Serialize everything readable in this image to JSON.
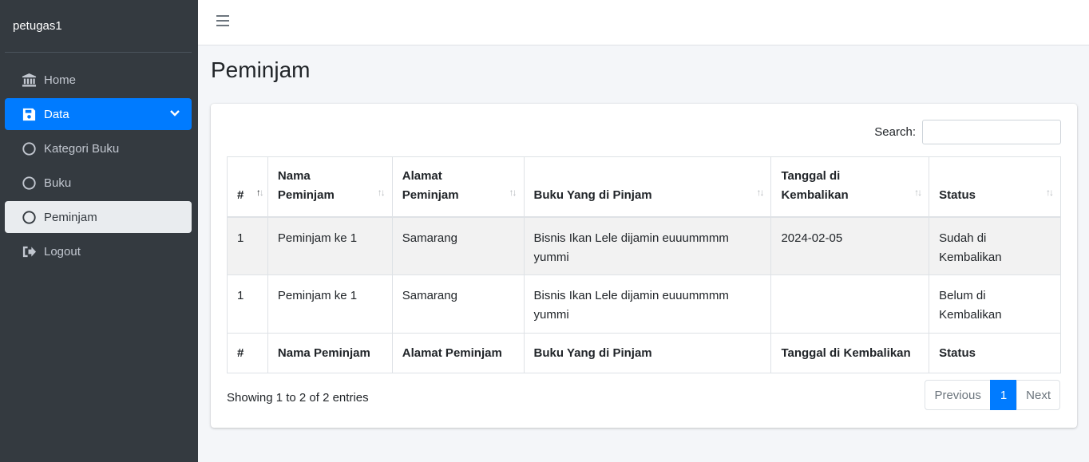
{
  "sidebar": {
    "user": "petugas1",
    "items": [
      {
        "label": "Home",
        "icon": "bank-icon"
      },
      {
        "label": "Data",
        "icon": "save-icon"
      },
      {
        "label": "Kategori Buku",
        "icon": "circle-icon"
      },
      {
        "label": "Buku",
        "icon": "circle-icon"
      },
      {
        "label": "Peminjam",
        "icon": "circle-icon"
      },
      {
        "label": "Logout",
        "icon": "sign-out-icon"
      }
    ]
  },
  "page": {
    "title": "Peminjam"
  },
  "search": {
    "label": "Search:",
    "value": ""
  },
  "table": {
    "headers": [
      "#",
      "Nama Peminjam",
      "Alamat Peminjam",
      "Buku Yang di Pinjam",
      "Tanggal di Kembalikan",
      "Status"
    ],
    "rows": [
      [
        "1",
        "Peminjam ke 1",
        "Samarang",
        "Bisnis Ikan Lele dijamin euuummmm yummi",
        "2024-02-05",
        "Sudah di Kembalikan"
      ],
      [
        "1",
        "Peminjam ke 1",
        "Samarang",
        "Bisnis Ikan Lele dijamin euuummmm yummi",
        "",
        "Belum di Kembalikan"
      ]
    ]
  },
  "footer": {
    "info": "Showing 1 to 2 of 2 entries",
    "prev": "Previous",
    "page": "1",
    "next": "Next"
  },
  "colors": {
    "sidebar": "#343a40",
    "accent": "#007bff",
    "bg": "#f4f6f9"
  }
}
